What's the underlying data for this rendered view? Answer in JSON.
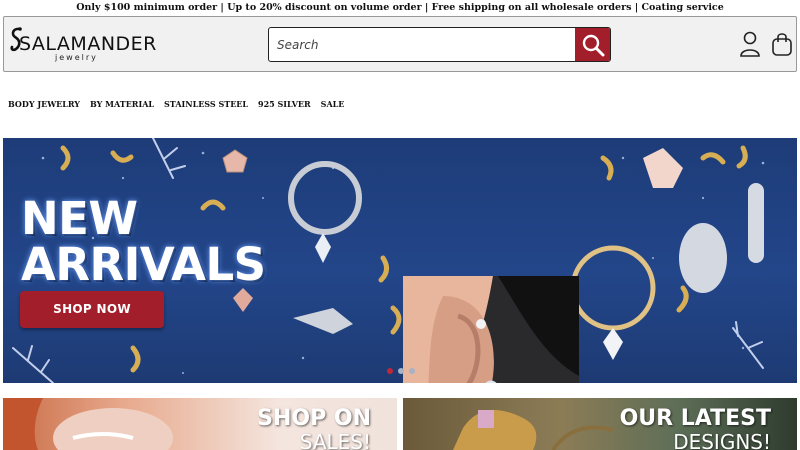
{
  "announcement": "Only $100 minimum order | Up to 20% discount on volume order | Free shipping on all wholesale orders | Coating service",
  "header": {
    "logo_word": "SALAMANDER",
    "logo_sub": "jewelry",
    "search_placeholder": "Search",
    "icons": [
      "search-icon",
      "user-icon",
      "cart-icon"
    ]
  },
  "nav": [
    "BODY JEWELRY",
    "BY MATERIAL",
    "STAINLESS STEEL",
    "925 SILVER",
    "SALE"
  ],
  "hero": {
    "title_line1": "NEW",
    "title_line2": "ARRIVALS",
    "cta": "SHOP NOW",
    "slide_count": 3,
    "active_slide": 1
  },
  "promos": [
    {
      "title": "SHOP ON",
      "subtitle": "SALES!"
    },
    {
      "title": "OUR LATEST",
      "subtitle": "DESIGNS!"
    }
  ],
  "colors": {
    "accent": "#a31e2b",
    "hero_bg": "#23468a",
    "header_bg": "#f1f1f1"
  }
}
